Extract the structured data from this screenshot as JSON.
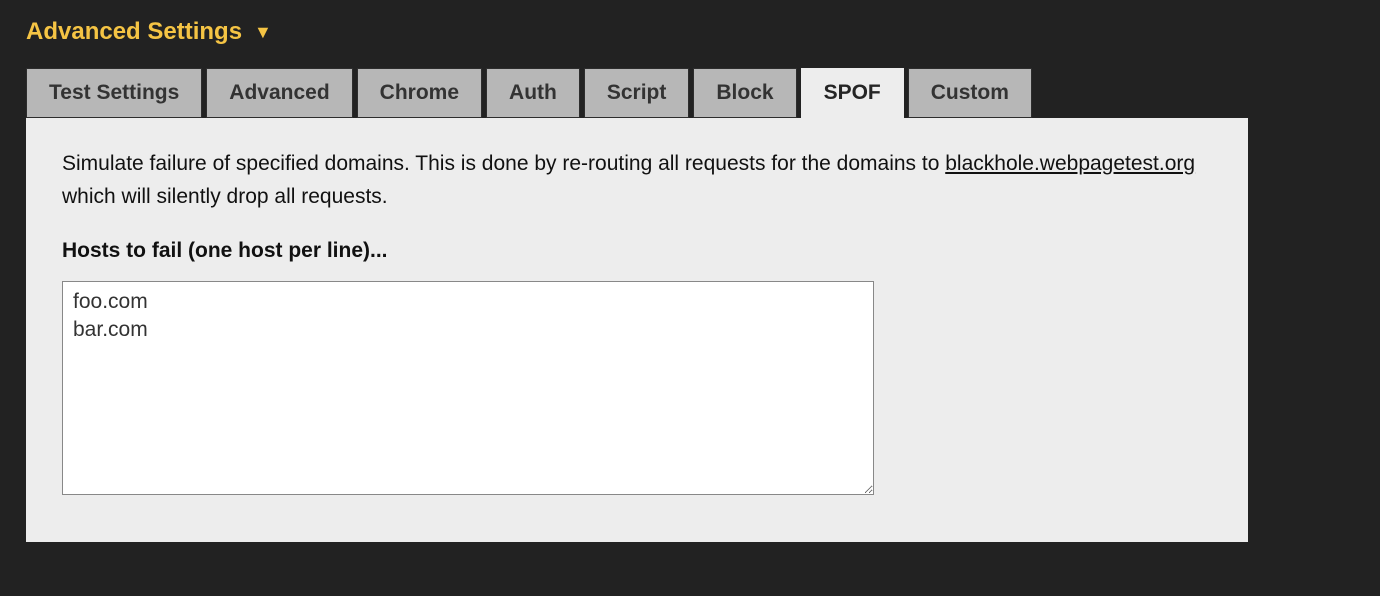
{
  "header": {
    "title": "Advanced Settings"
  },
  "tabs": [
    {
      "label": "Test Settings",
      "active": false
    },
    {
      "label": "Advanced",
      "active": false
    },
    {
      "label": "Chrome",
      "active": false
    },
    {
      "label": "Auth",
      "active": false
    },
    {
      "label": "Script",
      "active": false
    },
    {
      "label": "Block",
      "active": false
    },
    {
      "label": "SPOF",
      "active": true
    },
    {
      "label": "Custom",
      "active": false
    }
  ],
  "spof": {
    "desc_pre": "Simulate failure of specified domains. This is done by re-routing all requests for the domains to ",
    "desc_link": "blackhole.webpagetest.org",
    "desc_post": " which will silently drop all requests.",
    "hosts_label": "Hosts to fail (one host per line)...",
    "hosts_value": "foo.com\nbar.com"
  }
}
